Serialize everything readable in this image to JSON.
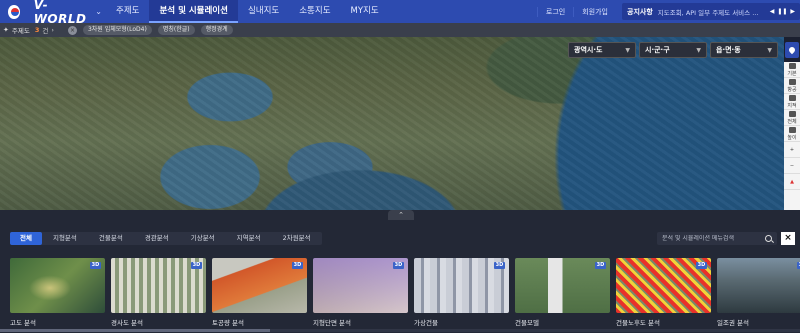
{
  "header": {
    "brand": "V-WORLD",
    "menu": [
      {
        "label": "주제도",
        "active": false
      },
      {
        "label": "분석 및 시뮬레이션",
        "active": true
      },
      {
        "label": "실내지도",
        "active": false
      },
      {
        "label": "소통지도",
        "active": false
      },
      {
        "label": "MY지도",
        "active": false
      }
    ],
    "login": "로그인",
    "signup": "회원가입",
    "notice_title": "공지사항",
    "notice_text": "지도조회, API 일부 주제도 서비스 ..."
  },
  "subbar": {
    "label": "주제도",
    "count": "3",
    "unit": "건",
    "chips": [
      "3차원 입체모형(LoD4)",
      "명칭(한글)",
      "행정경계"
    ]
  },
  "map": {
    "selectors": [
      "광역시·도",
      "시·군·구",
      "읍·면·동"
    ],
    "rail": [
      "기본",
      "항공",
      "지적",
      "전체",
      "높이"
    ]
  },
  "panel": {
    "tabs": [
      {
        "label": "전체",
        "active": true
      },
      {
        "label": "지형분석",
        "active": false
      },
      {
        "label": "건물분석",
        "active": false
      },
      {
        "label": "경관분석",
        "active": false
      },
      {
        "label": "기상분석",
        "active": false
      },
      {
        "label": "지역분석",
        "active": false
      },
      {
        "label": "2차원분석",
        "active": false
      }
    ],
    "search_placeholder": "분석 및 시뮬레이션 메뉴검색",
    "badge_3d": "3D",
    "cards": [
      {
        "label": "고도 분석"
      },
      {
        "label": "경사도 분석"
      },
      {
        "label": "토공량 분석"
      },
      {
        "label": "지형단면 분석"
      },
      {
        "label": "가상건물"
      },
      {
        "label": "건물모델"
      },
      {
        "label": "건물노후도 분석"
      },
      {
        "label": "일조권 분석"
      }
    ]
  }
}
